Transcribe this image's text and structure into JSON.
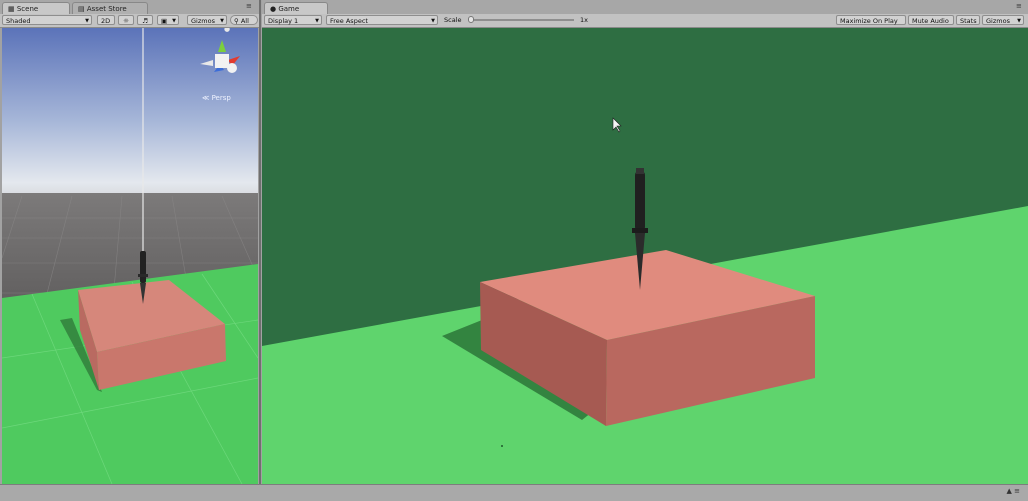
{
  "scene_panel": {
    "tabs": [
      {
        "label": "Scene",
        "icon": "scene-icon"
      },
      {
        "label": "Asset Store",
        "icon": "store-icon"
      }
    ],
    "toolbar": {
      "shading_mode": "Shaded",
      "mode_2d": "2D",
      "gizmos": "Gizmos",
      "search_value": "All"
    },
    "projection_label": "Persp",
    "colors": {
      "sky_top": "#5b73b9",
      "ground_green": "#55cc66",
      "box": "#d4867a"
    }
  },
  "game_panel": {
    "tab": {
      "label": "Game",
      "icon": "game-controller-icon"
    },
    "toolbar": {
      "display": "Display 1",
      "aspect": "Free Aspect",
      "scale_label": "Scale",
      "scale_value": "1x",
      "maximize_on_play": "Maximize On Play",
      "mute_audio": "Mute Audio",
      "stats": "Stats",
      "gizmos": "Gizmos"
    },
    "colors": {
      "background": "#2e6e42",
      "ground": "#5fd46d",
      "box_top": "#e08b7e",
      "box_front": "#b9685f",
      "box_side": "#a65a52"
    }
  }
}
